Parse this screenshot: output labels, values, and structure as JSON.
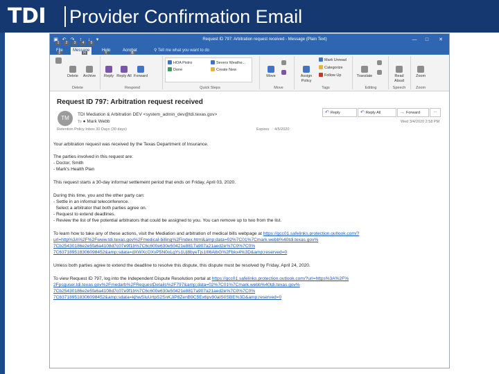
{
  "slide": {
    "logo": "TDI",
    "title": "Provider Confirmation Email"
  },
  "window": {
    "title": "Request ID 797: Arbitration request received  -  Message (Plain Text)",
    "keytips": [
      "1",
      "2",
      "3",
      "4",
      "5"
    ],
    "controls": [
      "—",
      "□",
      "✕"
    ]
  },
  "tabs": [
    "File",
    "Message",
    "Help",
    "Acrobat"
  ],
  "ribbon_keytips": [
    "F",
    "H",
    "Y",
    "B"
  ],
  "tell_me": "Tell me what you want to do",
  "ribbon": {
    "delete": {
      "delete": "Delete",
      "archive": "Archive"
    },
    "respond": {
      "reply": "Reply",
      "reply_all": "Reply All",
      "forward": "Forward"
    },
    "quick_steps": [
      "HOA Pistro",
      "Severs Weathe...",
      "Done",
      "Create New"
    ],
    "move": {
      "move": "Move"
    },
    "tags": {
      "assign_policy": "Assign Policy",
      "mark_unread": "Mark Unread",
      "categorize": "Categorize",
      "follow_up": "Follow Up"
    },
    "editing": {
      "translate": "Translate"
    },
    "speech": {
      "read_aloud": "Read Aloud"
    },
    "zoom": {
      "zoom": "Zoom"
    },
    "groups": [
      "Delete",
      "Respond",
      "Quick Steps",
      "Move",
      "Tags",
      "Editing",
      "Speech",
      "Zoom"
    ]
  },
  "message": {
    "subject": "Request ID 797: Arbitration request received",
    "avatar": "TM",
    "from": "TDI Mediation & Arbitration DEV <system_admin_dev@tdi.texas.gov>",
    "to_label": "To",
    "to": "Mark Webb",
    "retention": "Retention Policy   Inbox 30 Days (30 days)",
    "expires_label": "Expires",
    "expires": "4/5/2020",
    "date": "Wed 3/4/2020 2:58 PM",
    "actions": {
      "reply": "Reply",
      "reply_all": "Reply All",
      "forward": "Forward",
      "more": "···"
    }
  },
  "body": {
    "intro": "Your arbitration request was received by the Texas Department of Insurance.",
    "parties_heading": "The parties involved in this request are:",
    "parties": [
      "- Doctor, Smith",
      "- Mark's Health Plan"
    ],
    "period": "This request starts a 30-day informal settlement period that ends on Friday, April 03, 2020.",
    "during_heading": "During this time, you and the other party can:",
    "during_items": [
      "- Settle in an informal teleconference.",
      "  Select a arbitrator that both parties agree on.",
      "- Request to extend deadlines.",
      "- Review the list of five potential arbitrators that could be assigned to you. You can remove up to two from the list."
    ],
    "learn_text": "To learn how to take any of these actions, visit the Mediation and arbitration of medical bills webpage at ",
    "learn_links": [
      "https://gcc01.safelinks.protection.outlook.com/?",
      "url=http%3A%2F%2Fwww.tdi.texas.gov%2Fmedical-billing%2Findex.html&amp;data=02%7C01%7Cmark.webb%40tdi.texas.gov%",
      "7Cb25430186e2e5fa6a4108d7c07e9f1b%7C6c600e630e50421e8817a907a21aed2e%7C0%7C0%",
      "7C637189518306098452&amp;sdata=dXWXcOXvP5N0oLgYs1Uj8byeTjs1Ill6AlbG%2Fbkx4%3D&amp;reserved=0"
    ],
    "unless": "Unless both parties agree to extend the deadline to resolve this dispute, this dispute must be resolved by Friday, April 24, 2020.",
    "view_text": "To view Request ID 797, log into the Independent Dispute Resolution portal at ",
    "view_links": [
      "https://gcc01.safelinks.protection.outlook.com/?url=https%3A%2F%",
      "2Fpsguser.tdi.texas.gov%2Fmedarb%2FRequestDetails%2F797&amp;data=02%7C01%7Cmark.webb%40tdi.texas.gov%",
      "7Cb25430186e2e5fa6a4108d7c07e9f1b%7C6c600e630e50421e8817a907a21aed2e%7C0%7C0%",
      "7C637189518306098452&amp;sdata=kjhwSIuUrtpS2SnKJiP8ZenB9C5Ex6pv90aIS0SBE%3D&amp;reserved=0"
    ]
  },
  "colors": {
    "header": "#14386f",
    "outlook_blue": "#2f66b1",
    "link": "#1b57b5"
  }
}
